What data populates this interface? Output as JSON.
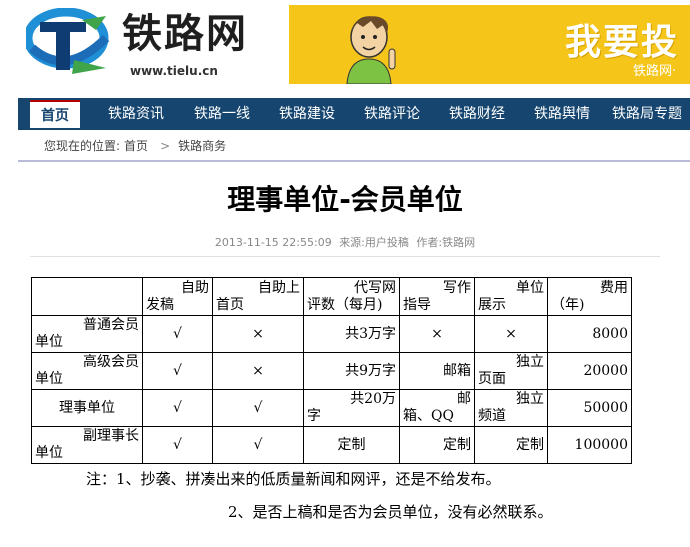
{
  "site": {
    "name": "铁路网",
    "url": "www.tielu.cn",
    "colors": {
      "nav": "#16466f",
      "banner": "#f5c51a",
      "accent": "#b40000"
    }
  },
  "banner": {
    "big_text": "我要投",
    "small_text": "铁路网·"
  },
  "nav": {
    "items": [
      "首页",
      "铁路资讯",
      "铁路一线",
      "铁路建设",
      "铁路评论",
      "铁路财经",
      "铁路舆情",
      "铁路局专题"
    ]
  },
  "breadcrumb": {
    "prefix": "您现在的位置:",
    "home": "首页",
    "separator": ">",
    "current": "铁路商务"
  },
  "article": {
    "title": "理事单位-会员单位",
    "datetime": "2013-11-15 22:55:09",
    "source_label": "来源:",
    "source": "用户投稿",
    "author_label": "作者:",
    "author": "铁路网"
  },
  "table": {
    "headers": [
      {
        "top": "",
        "bottom": ""
      },
      {
        "top": "自助",
        "bottom": "发稿"
      },
      {
        "top": "自助上",
        "bottom": "首页"
      },
      {
        "top": "代写网",
        "bottom": "评数（每月)"
      },
      {
        "top": "写作",
        "bottom": "指导"
      },
      {
        "top": "单位",
        "bottom": "展示"
      },
      {
        "top": "费用",
        "bottom": "（年)"
      }
    ],
    "rows": [
      {
        "name_top": "普通会员",
        "name_bottom": "单位",
        "self_post": "√",
        "self_home": "×",
        "ghost_top": "共3万字",
        "ghost_bottom": "",
        "guide_top": "×",
        "guide_bottom": "",
        "show_top": "×",
        "show_bottom": "",
        "fee": "8000"
      },
      {
        "name_top": "高级会员",
        "name_bottom": "单位",
        "self_post": "√",
        "self_home": "×",
        "ghost_top": "共9万字",
        "ghost_bottom": "",
        "guide_top": "邮箱",
        "guide_bottom": "",
        "show_top": "独立",
        "show_bottom": "页面",
        "fee": "20000"
      },
      {
        "name_top": "理事单位",
        "name_bottom": "",
        "self_post": "√",
        "self_home": "√",
        "ghost_top": "共20万",
        "ghost_bottom": "字",
        "guide_top": "邮",
        "guide_bottom": "箱、QQ",
        "show_top": "独立",
        "show_bottom": "频道",
        "fee": "50000"
      },
      {
        "name_top": "副理事长",
        "name_bottom": "单位",
        "self_post": "√",
        "self_home": "√",
        "ghost_top": "定制",
        "ghost_bottom": "",
        "guide_top": "定制",
        "guide_bottom": "",
        "show_top": "定制",
        "show_bottom": "",
        "fee": "100000"
      }
    ]
  },
  "notes": [
    "注：1、抄袭、拼凑出来的低质量新闻和网评，还是不给发布。",
    "2、是否上稿和是否为会员单位，没有必然联系。"
  ]
}
